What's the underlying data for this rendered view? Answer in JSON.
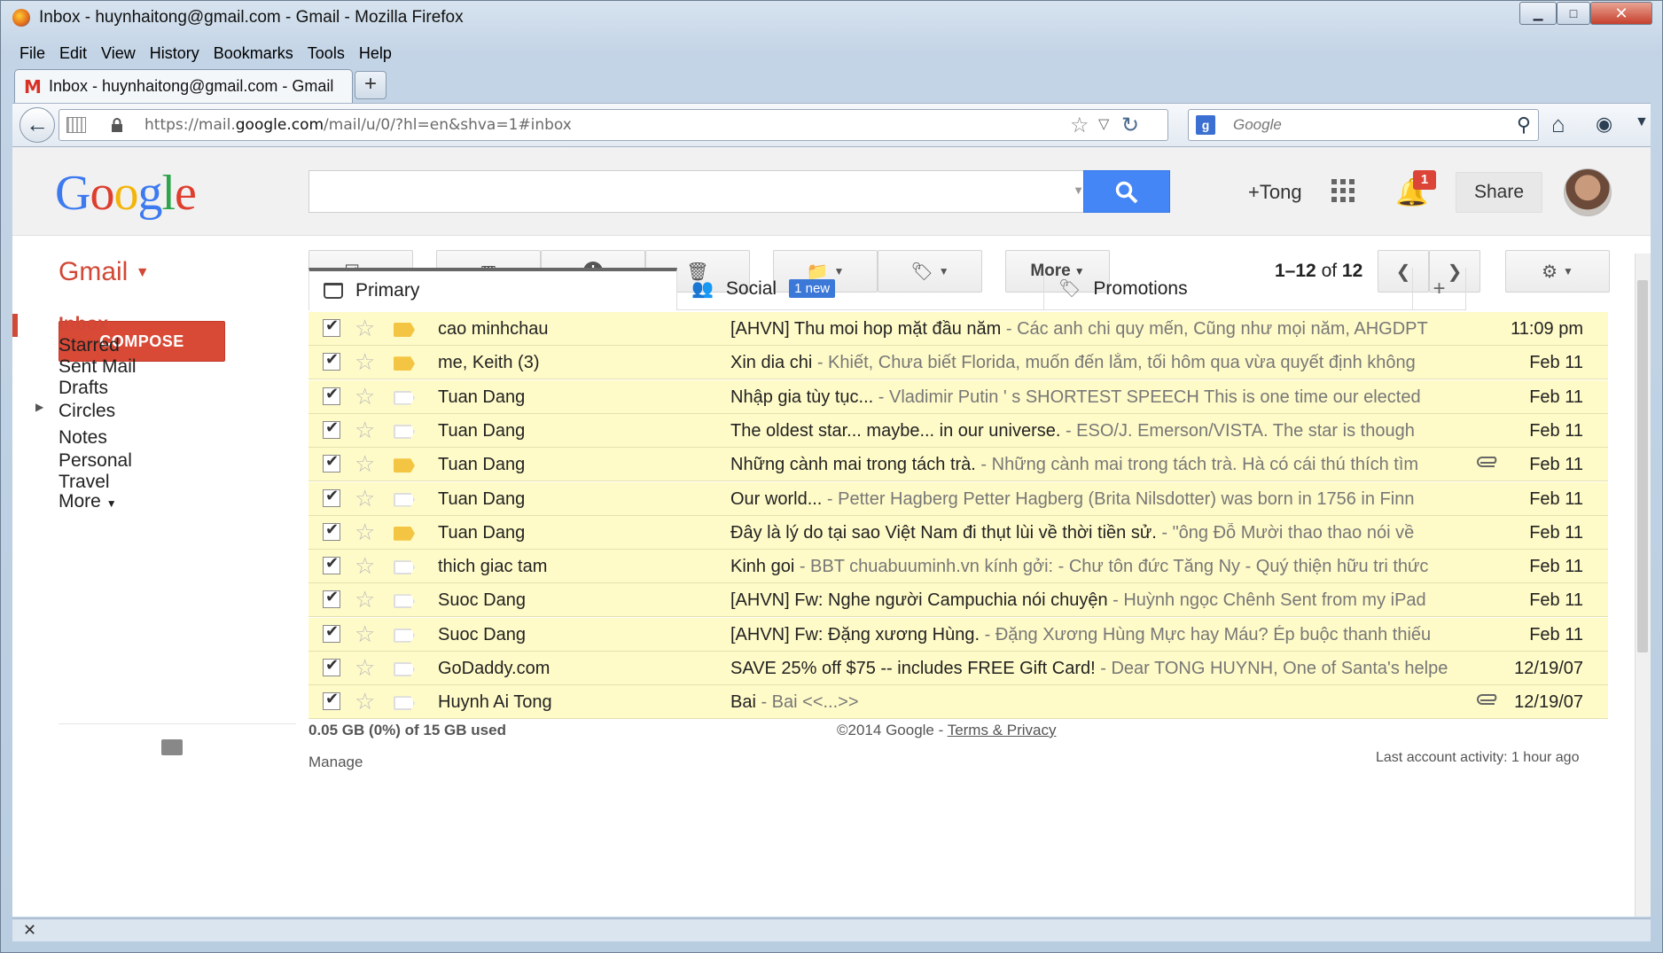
{
  "window": {
    "title": "Inbox - huynhaitong@gmail.com - Gmail - Mozilla Firefox",
    "controls": {
      "minimize": "▁",
      "maximize": "□",
      "close": "✕"
    }
  },
  "menu": [
    "File",
    "Edit",
    "View",
    "History",
    "Bookmarks",
    "Tools",
    "Help"
  ],
  "tab": {
    "title": "Inbox - huynhaitong@gmail.com - Gmail",
    "new_tab": "+"
  },
  "navbar": {
    "url_prefix": "https://mail.",
    "url_domain": "google.com",
    "url_rest": "/mail/u/0/?hl=en&shva=1#inbox",
    "search_engine_placeholder": "Google"
  },
  "gheader": {
    "logo": [
      "G",
      "o",
      "o",
      "g",
      "l",
      "e"
    ],
    "plus_user": "+Tong",
    "notification_count": "1",
    "share_label": "Share"
  },
  "toolbar": {
    "gmail_label": "Gmail",
    "more_label": "More",
    "page_range": "1–12",
    "page_of": "of",
    "page_total": "12"
  },
  "sidebar": {
    "compose_label": "COMPOSE",
    "items": [
      "Inbox",
      "Starred",
      "Sent Mail",
      "Drafts",
      "Circles",
      "Notes",
      "Personal",
      "Travel",
      "More"
    ]
  },
  "category_tabs": {
    "primary": "Primary",
    "social": "Social",
    "social_badge": "1 new",
    "promotions": "Promotions",
    "add": "+"
  },
  "emails": [
    {
      "sender": "cao minhchau",
      "subject": "[AHVN] Thu moi hop mặt đầu năm",
      "preview": " - Các anh chi quy mến, Cũng như mọi năm, AHGDPT",
      "date": "11:09 pm",
      "important": true,
      "attachment": false
    },
    {
      "sender": "me, Keith (3)",
      "subject": "Xin dia chi",
      "preview": " - Khiết, Chưa biết Florida, muốn đến lắm, tối hôm qua vừa quyết định không",
      "date": "Feb 11",
      "important": true,
      "attachment": false
    },
    {
      "sender": "Tuan Dang",
      "subject": "Nhập gia tùy tục...",
      "preview": " - Vladimir Putin ' s SHORTEST SPEECH This is one time our elected",
      "date": "Feb 11",
      "important": false,
      "attachment": false
    },
    {
      "sender": "Tuan Dang",
      "subject": "The oldest star... maybe... in our universe.",
      "preview": " - ESO/J. Emerson/VISTA. The star is though",
      "date": "Feb 11",
      "important": false,
      "attachment": false
    },
    {
      "sender": "Tuan Dang",
      "subject": "Những cành mai trong tách trà.",
      "preview": " - Những cành mai trong tách trà. Hà có cái thú thích tìm",
      "date": "Feb 11",
      "important": true,
      "attachment": true
    },
    {
      "sender": "Tuan Dang",
      "subject": "Our world...",
      "preview": " - Petter Hagberg Petter Hagberg (Brita Nilsdotter) was born in 1756 in Finn",
      "date": "Feb 11",
      "important": false,
      "attachment": false
    },
    {
      "sender": "Tuan Dang",
      "subject": "Đây là lý do tại sao Việt Nam đi thụt lùi về thời tiền sử.",
      "preview": " - \"ông Đỗ Mười thao thao nói về",
      "date": "Feb 11",
      "important": true,
      "attachment": false
    },
    {
      "sender": "thich giac tam",
      "subject": "Kinh goi",
      "preview": " - BBT chuabuuminh.vn kính gởi: - Chư tôn đức Tăng Ny - Quý thiện hữu tri thức",
      "date": "Feb 11",
      "important": false,
      "attachment": false
    },
    {
      "sender": "Suoc Dang",
      "subject": "[AHVN] Fw: Nghe người Campuchia nói chuyện",
      "preview": " - Huỳnh ngọc Chênh Sent from my iPad",
      "date": "Feb 11",
      "important": false,
      "attachment": false
    },
    {
      "sender": "Suoc Dang",
      "subject": "[AHVN] Fw: Đặng xương Hùng.",
      "preview": " - Đặng Xương Hùng Mực hay Máu? Ép buộc thanh thiếu",
      "date": "Feb 11",
      "important": false,
      "attachment": false
    },
    {
      "sender": "GoDaddy.com",
      "subject": "SAVE 25% off $75 -- includes FREE Gift Card!",
      "preview": " - Dear TONG HUYNH, One of Santa's helpers",
      "date": "12/19/07",
      "important": false,
      "attachment": false
    },
    {
      "sender": "Huynh Ai Tong",
      "subject": "Bai",
      "preview": " - Bai <<...>>",
      "date": "12/19/07",
      "important": false,
      "attachment": true
    }
  ],
  "footer": {
    "storage": "0.05 GB (0%) of 15 GB used",
    "manage": "Manage",
    "copyright": "©2014 Google - ",
    "terms": "Terms & Privacy",
    "activity": "Last account activity: 1 hour ago"
  },
  "statusbar": {
    "close": "✕"
  }
}
